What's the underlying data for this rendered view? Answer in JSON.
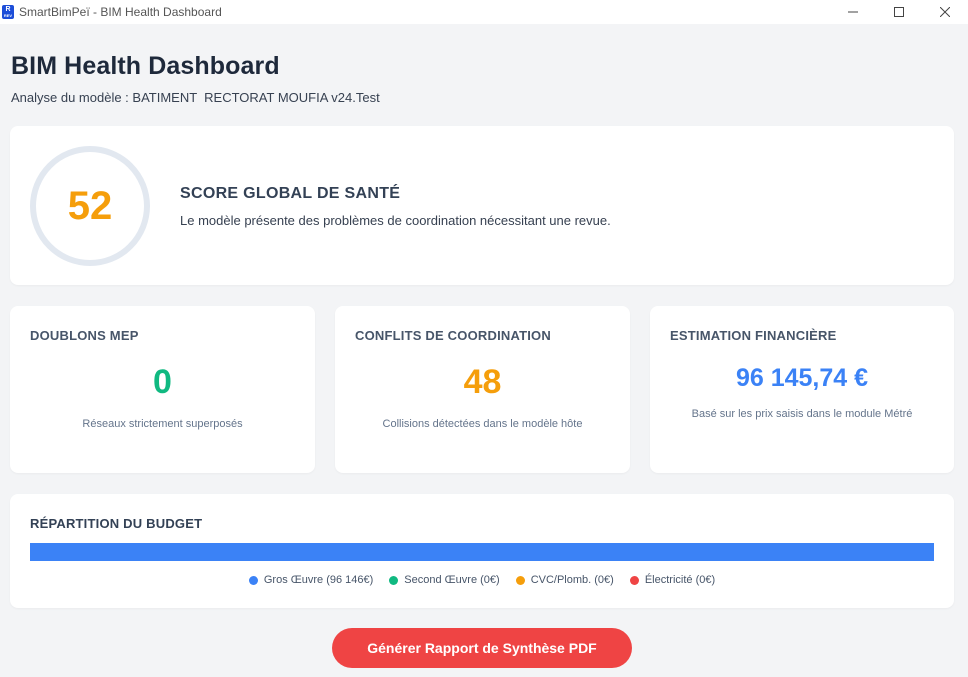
{
  "window": {
    "title": "SmartBimPeï - BIM Health Dashboard",
    "icon_top": "R",
    "icon_bottom": "REV"
  },
  "header": {
    "title": "BIM Health Dashboard",
    "subtitle": "Analyse du modèle : BATIMENT  RECTORAT MOUFIA v24.Test"
  },
  "score": {
    "value": "52",
    "heading": "SCORE GLOBAL DE SANTÉ",
    "description": "Le modèle présente des problèmes de coordination nécessitant une revue.",
    "color": "#f59e0b"
  },
  "stats": {
    "mep": {
      "heading": "DOUBLONS MEP",
      "value": "0",
      "note": "Réseaux strictement superposés",
      "color": "#10b981"
    },
    "conflicts": {
      "heading": "CONFLITS DE COORDINATION",
      "value": "48",
      "note": "Collisions détectées dans le modèle hôte",
      "color": "#f59e0b"
    },
    "finance": {
      "heading": "ESTIMATION FINANCIÈRE",
      "value": "96 145,74 €",
      "note": "Basé sur les prix saisis dans le module Métré",
      "color": "#3b82f6"
    }
  },
  "budget": {
    "heading": "RÉPARTITION DU BUDGET",
    "segments": [
      {
        "label": "Gros Œuvre (96 146€)",
        "share": 1.0,
        "color": "#3b82f6"
      },
      {
        "label": "Second Œuvre (0€)",
        "share": 0.0,
        "color": "#10b981"
      },
      {
        "label": "CVC/Plomb. (0€)",
        "share": 0.0,
        "color": "#f59e0b"
      },
      {
        "label": "Électricité (0€)",
        "share": 0.0,
        "color": "#ef4444"
      }
    ]
  },
  "actions": {
    "pdf_label": "Générer Rapport de Synthèse PDF"
  },
  "icons": {
    "minimize": "minimize-icon",
    "maximize": "maximize-icon",
    "close": "close-icon"
  }
}
